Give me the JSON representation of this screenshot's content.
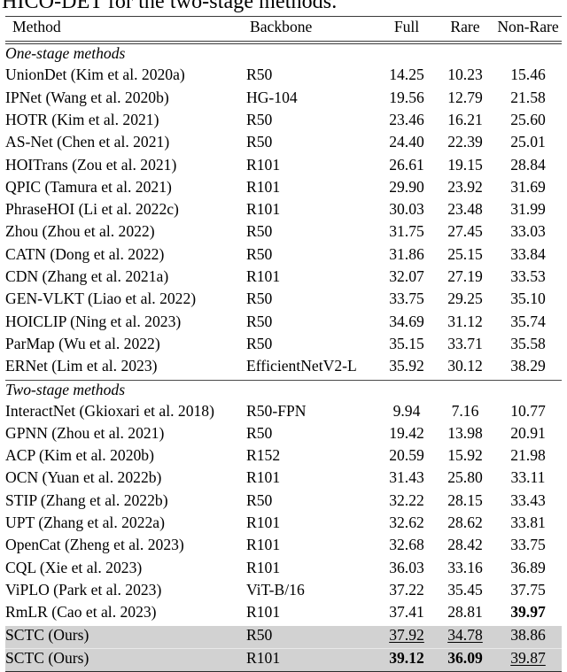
{
  "caption": {
    "text": "HICO-DET for the two-stage methods."
  },
  "table": {
    "columns": [
      "Method",
      "Backbone",
      "Full",
      "Rare",
      "Non-Rare"
    ],
    "sections": [
      {
        "label": "One-stage methods",
        "rows": [
          {
            "method": "UnionDet (Kim et al. 2020a)",
            "backbone": "R50",
            "full": "14.25",
            "rare": "10.23",
            "nonrare": "15.46"
          },
          {
            "method": "IPNet (Wang et al. 2020b)",
            "backbone": "HG-104",
            "full": "19.56",
            "rare": "12.79",
            "nonrare": "21.58"
          },
          {
            "method": "HOTR (Kim et al. 2021)",
            "backbone": "R50",
            "full": "23.46",
            "rare": "16.21",
            "nonrare": "25.60"
          },
          {
            "method": "AS-Net (Chen et al. 2021)",
            "backbone": "R50",
            "full": "24.40",
            "rare": "22.39",
            "nonrare": "25.01"
          },
          {
            "method": "HOITrans (Zou et al. 2021)",
            "backbone": "R101",
            "full": "26.61",
            "rare": "19.15",
            "nonrare": "28.84"
          },
          {
            "method": "QPIC (Tamura et al. 2021)",
            "backbone": "R101",
            "full": "29.90",
            "rare": "23.92",
            "nonrare": "31.69"
          },
          {
            "method": "PhraseHOI (Li et al. 2022c)",
            "backbone": "R101",
            "full": "30.03",
            "rare": "23.48",
            "nonrare": "31.99"
          },
          {
            "method": "Zhou (Zhou et al. 2022)",
            "backbone": "R50",
            "full": "31.75",
            "rare": "27.45",
            "nonrare": "33.03"
          },
          {
            "method": "CATN (Dong et al. 2022)",
            "backbone": "R50",
            "full": "31.86",
            "rare": "25.15",
            "nonrare": "33.84"
          },
          {
            "method": "CDN (Zhang et al. 2021a)",
            "backbone": "R101",
            "full": "32.07",
            "rare": "27.19",
            "nonrare": "33.53"
          },
          {
            "method": "GEN-VLKT (Liao et al. 2022)",
            "backbone": "R50",
            "full": "33.75",
            "rare": "29.25",
            "nonrare": "35.10"
          },
          {
            "method": "HOICLIP (Ning et al. 2023)",
            "backbone": "R50",
            "full": "34.69",
            "rare": "31.12",
            "nonrare": "35.74"
          },
          {
            "method": "ParMap (Wu et al. 2022)",
            "backbone": "R50",
            "full": "35.15",
            "rare": "33.71",
            "nonrare": "35.58"
          },
          {
            "method": "ERNet (Lim et al. 2023)",
            "backbone": "EfficientNetV2-L",
            "full": "35.92",
            "rare": "30.12",
            "nonrare": "38.29"
          }
        ]
      },
      {
        "label": "Two-stage methods",
        "rows": [
          {
            "method": "InteractNet (Gkioxari et al. 2018)",
            "backbone": "R50-FPN",
            "full": "9.94",
            "rare": "7.16",
            "nonrare": "10.77"
          },
          {
            "method": "GPNN (Zhou et al. 2021)",
            "backbone": "R50",
            "full": "19.42",
            "rare": "13.98",
            "nonrare": "20.91"
          },
          {
            "method": "ACP (Kim et al. 2020b)",
            "backbone": "R152",
            "full": "20.59",
            "rare": "15.92",
            "nonrare": "21.98"
          },
          {
            "method": "OCN (Yuan et al. 2022b)",
            "backbone": "R101",
            "full": "31.43",
            "rare": "25.80",
            "nonrare": "33.11"
          },
          {
            "method": "STIP (Zhang et al. 2022b)",
            "backbone": "R50",
            "full": "32.22",
            "rare": "28.15",
            "nonrare": "33.43"
          },
          {
            "method": "UPT (Zhang et al. 2022a)",
            "backbone": "R101",
            "full": "32.62",
            "rare": "28.62",
            "nonrare": "33.81"
          },
          {
            "method": "OpenCat (Zheng et al. 2023)",
            "backbone": "R101",
            "full": "32.68",
            "rare": "28.42",
            "nonrare": "33.75"
          },
          {
            "method": "CQL (Xie et al. 2023)",
            "backbone": "R101",
            "full": "36.03",
            "rare": "33.16",
            "nonrare": "36.89"
          },
          {
            "method": "ViPLO (Park et al. 2023)",
            "backbone": "ViT-B/16",
            "full": "37.22",
            "rare": "35.45",
            "nonrare": "37.75"
          },
          {
            "method": "RmLR (Cao et al. 2023)",
            "backbone": "R101",
            "full": "37.41",
            "rare": "28.81",
            "nonrare": "39.97",
            "nonrare_style": "bold"
          },
          {
            "method": "SCTC (Ours)",
            "backbone": "R50",
            "full": "37.92",
            "rare": "34.78",
            "nonrare": "38.86",
            "highlight": true,
            "full_style": "underline",
            "rare_style": "underline"
          },
          {
            "method": "SCTC (Ours)",
            "backbone": "R101",
            "full": "39.12",
            "rare": "36.09",
            "nonrare": "39.87",
            "highlight": true,
            "full_style": "bold",
            "rare_style": "bold",
            "nonrare_style": "underline"
          }
        ]
      }
    ]
  },
  "colors": {
    "highlight_row": "#d2d2d2",
    "rule": "#3a3a3a",
    "text": "#000000"
  }
}
